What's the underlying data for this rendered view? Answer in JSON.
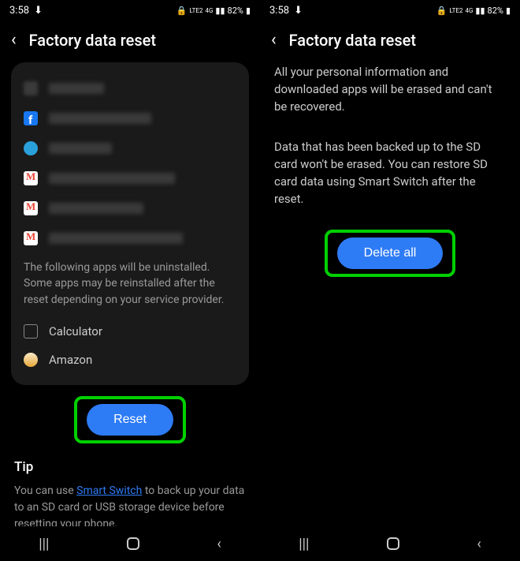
{
  "status": {
    "time": "3:58",
    "lte": "LTE2",
    "signal": "4G",
    "battery": "82%"
  },
  "left": {
    "title": "Factory data reset",
    "card_text": "The following apps will be uninstalled. Some apps may be reinstalled after the reset depending on your service provider.",
    "apps": {
      "calculator": "Calculator",
      "amazon": "Amazon"
    },
    "reset_btn": "Reset",
    "tip_title": "Tip",
    "tip_before": "You can use ",
    "tip_link": "Smart Switch",
    "tip_after": " to back up your data to an SD card or USB storage device before resetting your phone."
  },
  "right": {
    "title": "Factory data reset",
    "para1": "All your personal information and downloaded apps will be erased and can't be recovered.",
    "para2": "Data that has been backed up to the SD card won't be erased. You can restore SD card data using Smart Switch after the reset.",
    "delete_btn": "Delete all"
  }
}
